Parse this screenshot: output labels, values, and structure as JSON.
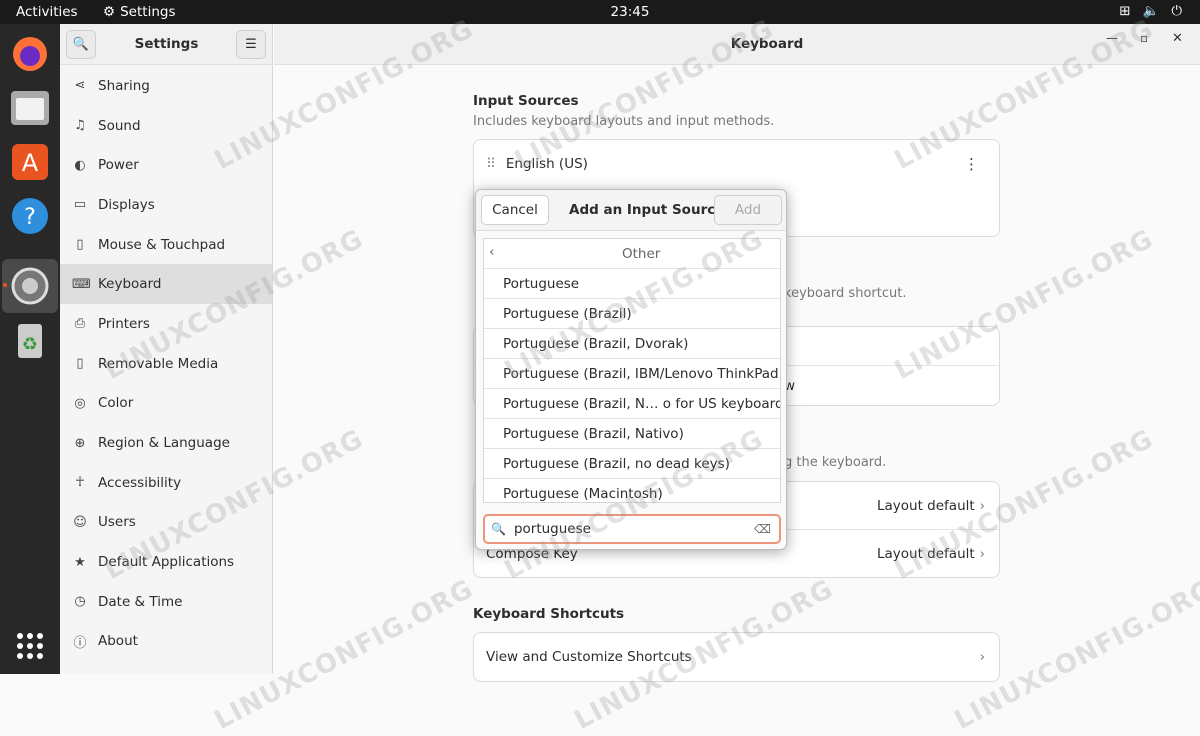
{
  "topbar": {
    "activities": "Activities",
    "app": "Settings",
    "clock": "23:45"
  },
  "sidebar": {
    "title": "Settings",
    "items": [
      {
        "label": "Sharing",
        "icon": "share-icon"
      },
      {
        "label": "Sound",
        "icon": "music-note-icon"
      },
      {
        "label": "Power",
        "icon": "power-icon"
      },
      {
        "label": "Displays",
        "icon": "display-icon"
      },
      {
        "label": "Mouse & Touchpad",
        "icon": "mouse-icon"
      },
      {
        "label": "Keyboard",
        "icon": "keyboard-icon"
      },
      {
        "label": "Printers",
        "icon": "printer-icon"
      },
      {
        "label": "Removable Media",
        "icon": "removable-media-icon"
      },
      {
        "label": "Color",
        "icon": "color-icon"
      },
      {
        "label": "Region & Language",
        "icon": "globe-icon"
      },
      {
        "label": "Accessibility",
        "icon": "accessibility-icon"
      },
      {
        "label": "Users",
        "icon": "users-icon"
      },
      {
        "label": "Default Applications",
        "icon": "star-icon"
      },
      {
        "label": "Date & Time",
        "icon": "clock-icon"
      },
      {
        "label": "About",
        "icon": "info-icon"
      }
    ],
    "selected": "Keyboard"
  },
  "main": {
    "title": "Keyboard",
    "input_sources": {
      "title": "Input Sources",
      "subtitle": "Includes keyboard layouts and input methods.",
      "first": "English (US)"
    },
    "partial_texts": {
      "shortcut": "keyboard shortcut.",
      "w": "w",
      "typing": "g the keyboard."
    },
    "special": {
      "alternate_value": "Layout default",
      "compose_label": "Compose Key",
      "compose_value": "Layout default"
    },
    "shortcuts": {
      "title": "Keyboard Shortcuts",
      "row": "View and Customize Shortcuts"
    }
  },
  "dialog": {
    "cancel": "Cancel",
    "title": "Add an Input Source",
    "add": "Add",
    "group": "Other",
    "items": [
      "Portuguese",
      "Portuguese (Brazil)",
      "Portuguese (Brazil, Dvorak)",
      "Portuguese (Brazil, IBM/Lenovo ThinkPad)",
      "Portuguese (Brazil, N… o for US keyboards)",
      "Portuguese (Brazil, Nativo)",
      "Portuguese (Brazil, no dead keys)",
      "Portuguese (Macintosh)"
    ],
    "search": "portuguese"
  },
  "watermark": "LINUXCONFIG.ORG",
  "colors": {
    "topbar": "#1a1a1a",
    "dock": "#282828",
    "search_focus": "#e9967a"
  }
}
